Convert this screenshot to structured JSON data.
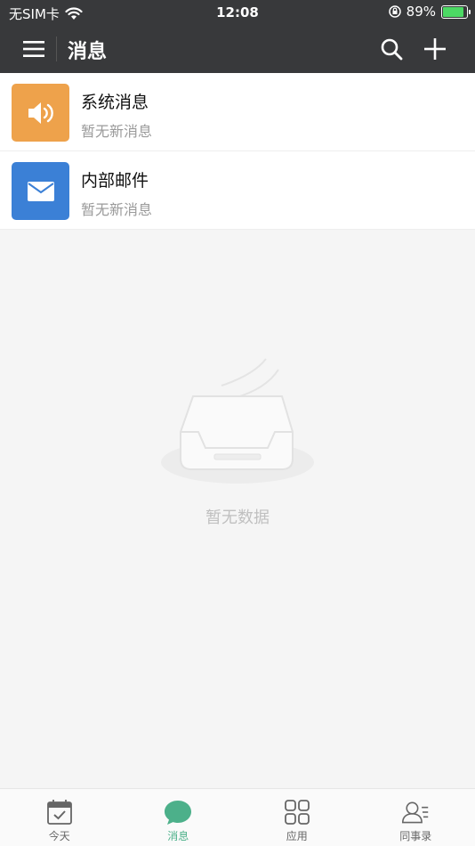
{
  "status_bar": {
    "carrier": "无SIM卡",
    "time": "12:08",
    "battery": "89%",
    "battery_level": 0.89
  },
  "nav": {
    "title": "消息"
  },
  "list": [
    {
      "name": "系统消息",
      "sub": "暂无新消息",
      "icon": "speaker-icon",
      "color": "#eea24b"
    },
    {
      "name": "内部邮件",
      "sub": "暂无新消息",
      "icon": "envelope-icon",
      "color": "#3b80d6"
    }
  ],
  "empty": {
    "text": "暂无数据"
  },
  "tabs": [
    {
      "label": "今天",
      "icon": "calendar-check-icon",
      "active": false
    },
    {
      "label": "消息",
      "icon": "chat-bubble-icon",
      "active": true
    },
    {
      "label": "应用",
      "icon": "apps-grid-icon",
      "active": false
    },
    {
      "label": "同事录",
      "icon": "contacts-icon",
      "active": false
    }
  ],
  "colors": {
    "header": "#38393b",
    "accent": "#4cb08a"
  }
}
